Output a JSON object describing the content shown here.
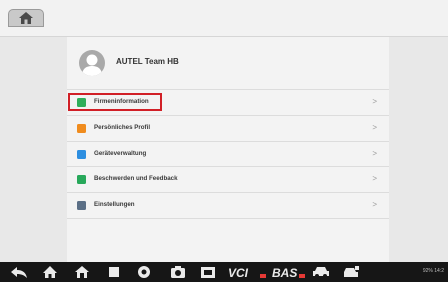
{
  "user": {
    "name": "AUTEL Team HB"
  },
  "menu": [
    {
      "label": "Firmeninformation",
      "icon": "company-icon",
      "color": "#2fae5a"
    },
    {
      "label": "Persönliches Profil",
      "icon": "profile-icon",
      "color": "#f08c1e"
    },
    {
      "label": "Geräteverwaltung",
      "icon": "device-icon",
      "color": "#2d8ee0"
    },
    {
      "label": "Beschwerden und Feedback",
      "icon": "feedback-icon",
      "color": "#27a85a"
    },
    {
      "label": "Einstellungen",
      "icon": "settings-icon",
      "color": "#5b6f86"
    }
  ],
  "chevron": ">",
  "highlight_color": "#d11f26",
  "nav": {
    "vci_label": "VCI",
    "bas_label": "BAS"
  },
  "status": {
    "text": "92% 14:2"
  }
}
